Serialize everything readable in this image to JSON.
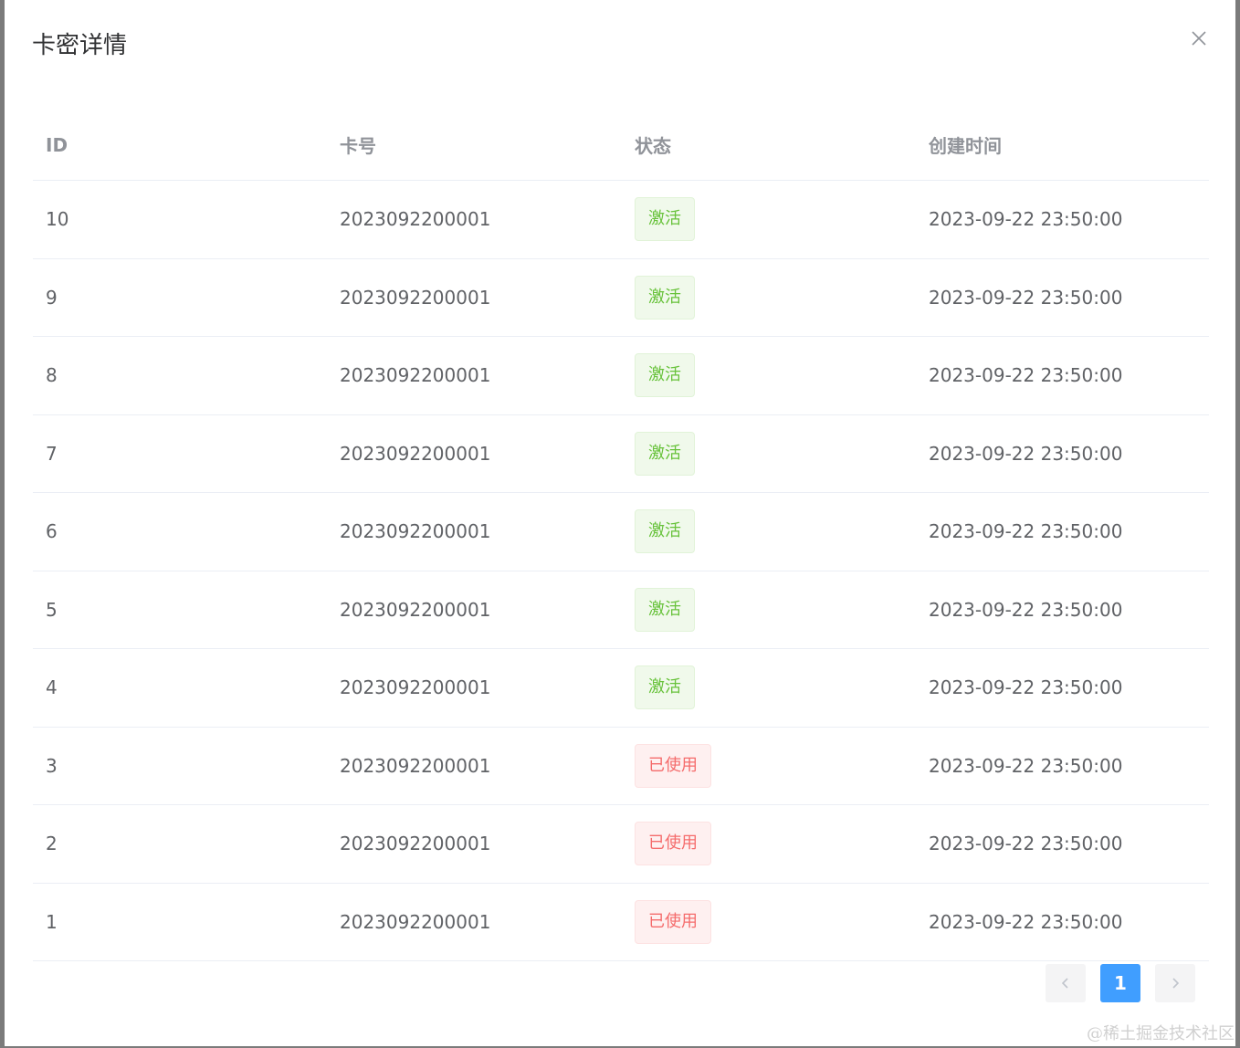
{
  "dialog": {
    "title": "卡密详情"
  },
  "table": {
    "headers": {
      "id": "ID",
      "card_no": "卡号",
      "status": "状态",
      "created_at": "创建时间"
    },
    "rows": [
      {
        "id": "10",
        "card_no": "2023092200001",
        "status": "激活",
        "status_type": "success",
        "created_at": "2023-09-22 23:50:00"
      },
      {
        "id": "9",
        "card_no": "2023092200001",
        "status": "激活",
        "status_type": "success",
        "created_at": "2023-09-22 23:50:00"
      },
      {
        "id": "8",
        "card_no": "2023092200001",
        "status": "激活",
        "status_type": "success",
        "created_at": "2023-09-22 23:50:00"
      },
      {
        "id": "7",
        "card_no": "2023092200001",
        "status": "激活",
        "status_type": "success",
        "created_at": "2023-09-22 23:50:00"
      },
      {
        "id": "6",
        "card_no": "2023092200001",
        "status": "激活",
        "status_type": "success",
        "created_at": "2023-09-22 23:50:00"
      },
      {
        "id": "5",
        "card_no": "2023092200001",
        "status": "激活",
        "status_type": "success",
        "created_at": "2023-09-22 23:50:00"
      },
      {
        "id": "4",
        "card_no": "2023092200001",
        "status": "激活",
        "status_type": "success",
        "created_at": "2023-09-22 23:50:00"
      },
      {
        "id": "3",
        "card_no": "2023092200001",
        "status": "已使用",
        "status_type": "danger",
        "created_at": "2023-09-22 23:50:00"
      },
      {
        "id": "2",
        "card_no": "2023092200001",
        "status": "已使用",
        "status_type": "danger",
        "created_at": "2023-09-22 23:50:00"
      },
      {
        "id": "1",
        "card_no": "2023092200001",
        "status": "已使用",
        "status_type": "danger",
        "created_at": "2023-09-22 23:50:00"
      }
    ]
  },
  "pagination": {
    "current_page": "1",
    "prev_icon": "chevron-left-icon",
    "next_icon": "chevron-right-icon"
  },
  "watermark": "@稀土掘金技术社区",
  "colors": {
    "success_text": "#67c23a",
    "danger_text": "#f56c6c",
    "active_page": "#409eff"
  }
}
